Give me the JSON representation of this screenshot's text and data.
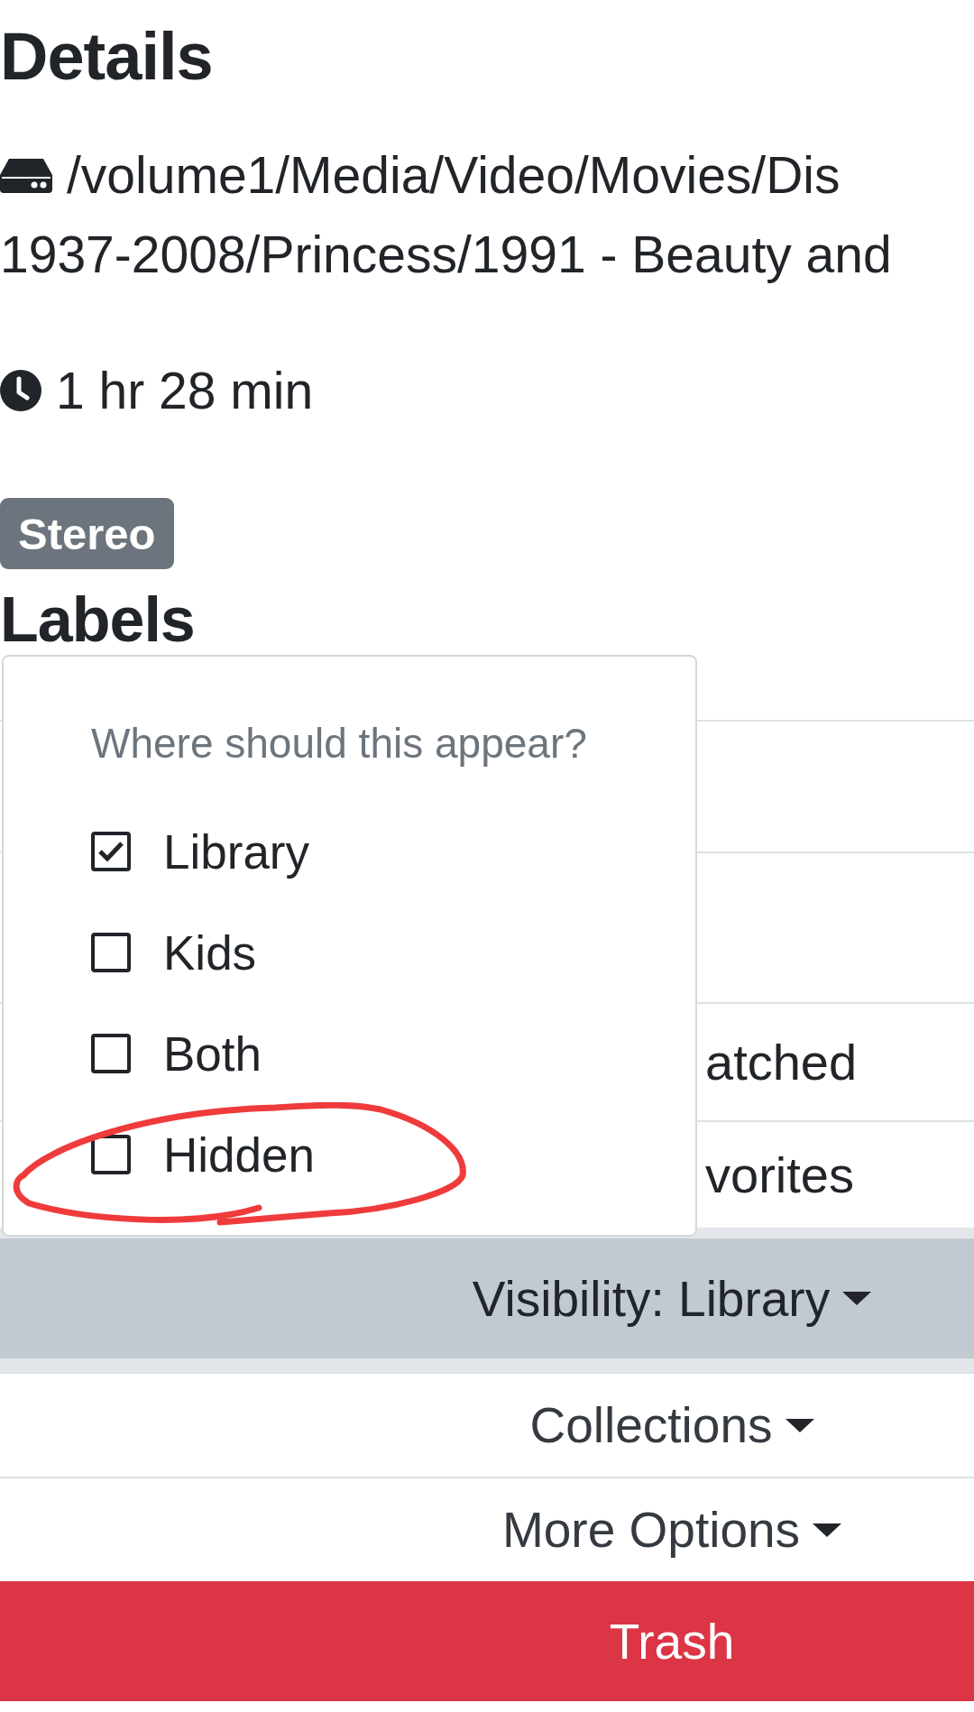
{
  "heading": "Details",
  "path": {
    "lines": [
      "/volume1/Media/Video/Movies/Dis",
      "1937-2008/Princess/1991 - Beauty and"
    ]
  },
  "duration": "1 hr 28 min",
  "badges": [
    {
      "label": "Stereo"
    }
  ],
  "labels_heading": "Labels",
  "list_rows": [
    {
      "kind": "blank"
    },
    {
      "kind": "blank"
    },
    {
      "kind": "text",
      "label": "atched"
    },
    {
      "kind": "text",
      "label": "vorites"
    }
  ],
  "visibility_menu": {
    "open": true,
    "header": "Where should this appear?",
    "options": [
      {
        "label": "Library",
        "checked": true,
        "annotated": false
      },
      {
        "label": "Kids",
        "checked": false,
        "annotated": false
      },
      {
        "label": "Both",
        "checked": false,
        "annotated": false
      },
      {
        "label": "Hidden",
        "checked": false,
        "annotated": true
      }
    ]
  },
  "actions": [
    {
      "kind": "dropdown",
      "label": "Visibility: Library",
      "active": true
    },
    {
      "kind": "dropdown",
      "label": "Collections",
      "active": false
    },
    {
      "kind": "dropdown",
      "label": "More Options",
      "active": false
    },
    {
      "kind": "danger",
      "label": "Trash",
      "active": false
    }
  ]
}
